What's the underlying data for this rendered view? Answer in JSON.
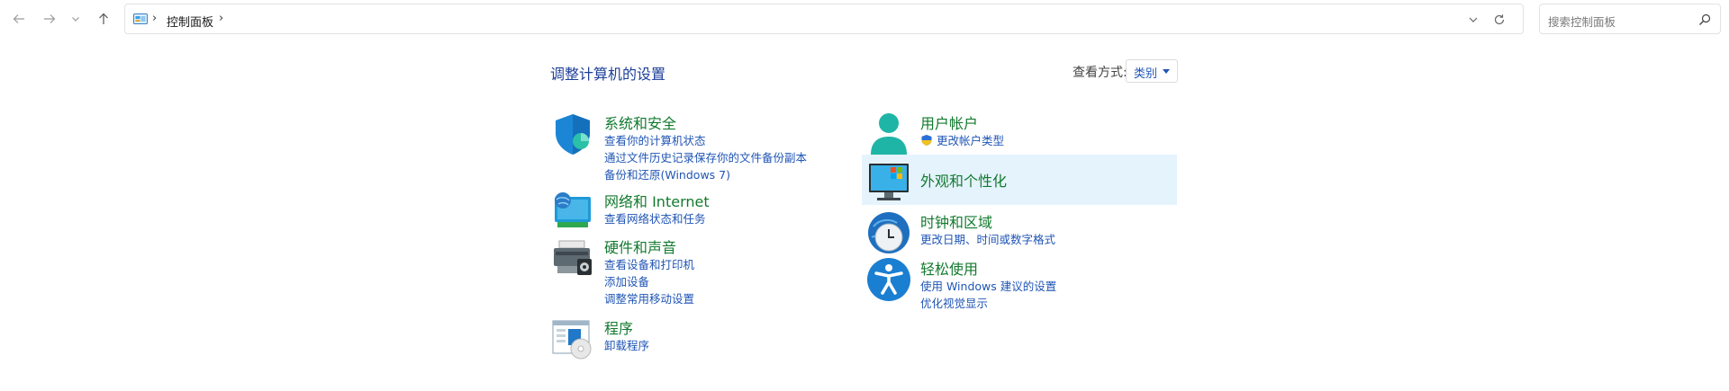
{
  "address_bar": {
    "breadcrumb": "控制面板",
    "separator": "›"
  },
  "search": {
    "placeholder": "搜索控制面板"
  },
  "page": {
    "title": "调整计算机的设置",
    "view_by_label": "查看方式:",
    "view_by_value": "类别"
  },
  "categories_left": [
    {
      "title": "系统和安全",
      "links": [
        "查看你的计算机状态",
        "通过文件历史记录保存你的文件备份副本",
        "备份和还原(Windows 7)"
      ],
      "icon": "shield-icon"
    },
    {
      "title": "网络和 Internet",
      "links": [
        "查看网络状态和任务"
      ],
      "icon": "network-globe-icon"
    },
    {
      "title": "硬件和声音",
      "links": [
        "查看设备和打印机",
        "添加设备",
        "调整常用移动设置"
      ],
      "icon": "printer-icon"
    },
    {
      "title": "程序",
      "links": [
        "卸载程序"
      ],
      "icon": "programs-disc-icon"
    }
  ],
  "categories_right": [
    {
      "title": "用户帐户",
      "links": [
        "更改帐户类型"
      ],
      "icon": "user-icon"
    },
    {
      "title": "外观和个性化",
      "links": [],
      "icon": "monitor-palette-icon"
    },
    {
      "title": "时钟和区域",
      "links": [
        "更改日期、时间或数字格式"
      ],
      "icon": "clock-globe-icon"
    },
    {
      "title": "轻松使用",
      "links": [
        "使用 Windows 建议的设置",
        "优化视觉显示"
      ],
      "icon": "accessibility-icon"
    }
  ],
  "colors": {
    "heading_green": "#127a2e",
    "link_blue": "#1f55b5",
    "title_blue": "#1d3f99",
    "hover_highlight": "#e5f3fd"
  }
}
